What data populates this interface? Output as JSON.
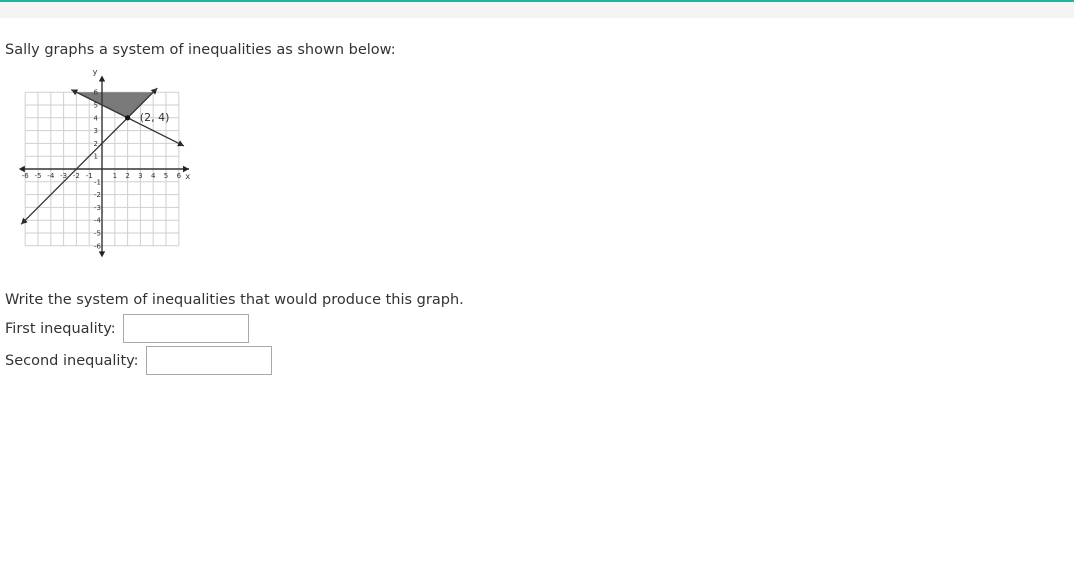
{
  "header": {
    "accent_color": "#1fb59a"
  },
  "prompt": "Sally graphs a system of inequalities as shown below:",
  "graph": {
    "x_label": "x",
    "y_label": "y",
    "x_ticks": [
      "-6",
      "-5",
      "-4",
      "-3",
      "-2",
      "-1",
      "1",
      "2",
      "3",
      "4",
      "5",
      "6"
    ],
    "y_ticks_pos": [
      "1",
      "2",
      "3",
      "4",
      "5",
      "6"
    ],
    "y_ticks_neg": [
      "-1",
      "-2",
      "-3",
      "-4",
      "-5",
      "-6"
    ],
    "point_label": "(2, 4)",
    "shade_color": "#7a7a7a"
  },
  "chart_data": {
    "type": "line",
    "title": "",
    "xlabel": "x",
    "ylabel": "y",
    "xlim": [
      -6,
      6
    ],
    "ylim": [
      -6,
      6
    ],
    "grid": true,
    "series": [
      {
        "x": [
          -6,
          4
        ],
        "y": [
          -4,
          6
        ]
      },
      {
        "x": [
          -2,
          6
        ],
        "y": [
          6,
          2
        ]
      }
    ],
    "points": [
      {
        "x": 2,
        "y": 4,
        "label": "(2, 4)"
      }
    ],
    "shaded_region": {
      "vertices": [
        [
          -2,
          6
        ],
        [
          2,
          4
        ],
        [
          4,
          6
        ]
      ]
    }
  },
  "question": "Write the system of inequalities that would produce this graph.",
  "inputs": {
    "first_label": "First inequality:",
    "first_value": "",
    "second_label": "Second inequality:",
    "second_value": ""
  }
}
